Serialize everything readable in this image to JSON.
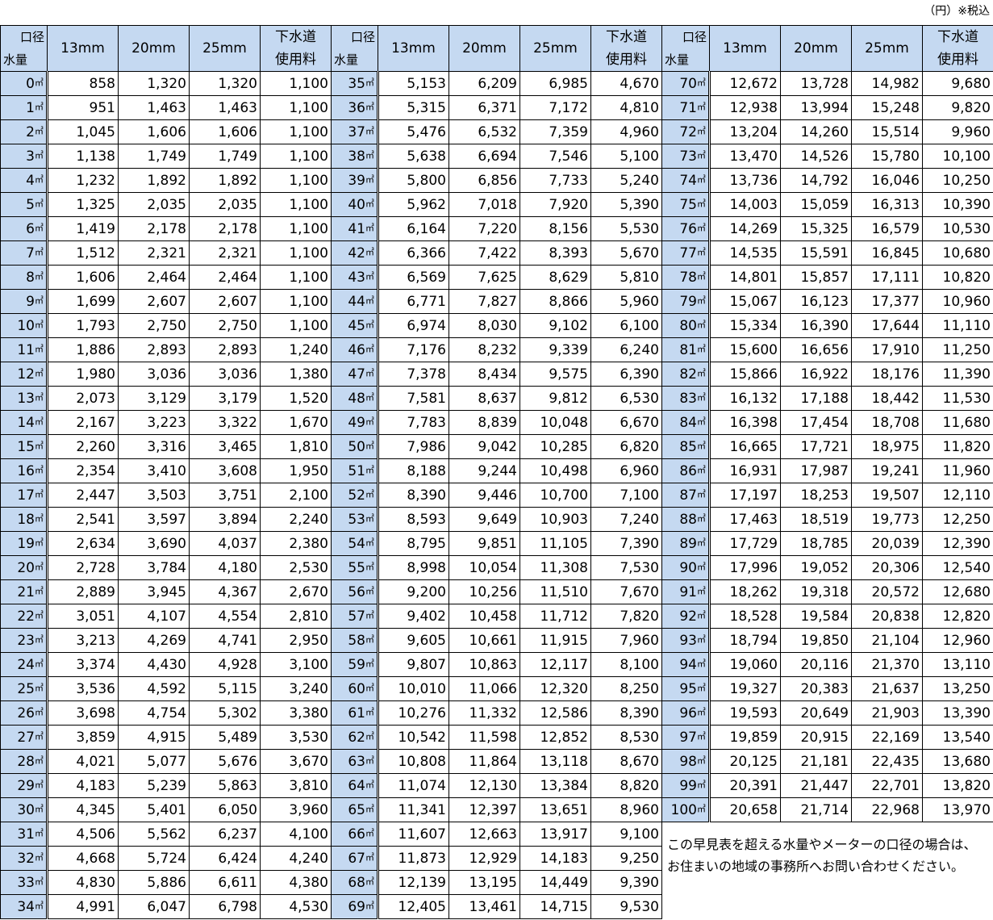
{
  "unit_note": "（円）※税込",
  "header": {
    "corner_top": "口径",
    "corner_bottom": "水量",
    "col_13": "13mm",
    "col_20": "20mm",
    "col_25": "25mm",
    "sewer_line1": "下水道",
    "sewer_line2": "使用料"
  },
  "unit_suffix": "㎥",
  "note": "この早見表を超える水量やメーターの口径の場合は、お住まいの地域の事務所へお問い合わせください。",
  "table": [
    [
      [
        "0",
        "858",
        "1,320",
        "1,320",
        "1,100"
      ],
      [
        "35",
        "5,153",
        "6,209",
        "6,985",
        "4,670"
      ],
      [
        "70",
        "12,672",
        "13,728",
        "14,982",
        "9,680"
      ]
    ],
    [
      [
        "1",
        "951",
        "1,463",
        "1,463",
        "1,100"
      ],
      [
        "36",
        "5,315",
        "6,371",
        "7,172",
        "4,810"
      ],
      [
        "71",
        "12,938",
        "13,994",
        "15,248",
        "9,820"
      ]
    ],
    [
      [
        "2",
        "1,045",
        "1,606",
        "1,606",
        "1,100"
      ],
      [
        "37",
        "5,476",
        "6,532",
        "7,359",
        "4,960"
      ],
      [
        "72",
        "13,204",
        "14,260",
        "15,514",
        "9,960"
      ]
    ],
    [
      [
        "3",
        "1,138",
        "1,749",
        "1,749",
        "1,100"
      ],
      [
        "38",
        "5,638",
        "6,694",
        "7,546",
        "5,100"
      ],
      [
        "73",
        "13,470",
        "14,526",
        "15,780",
        "10,100"
      ]
    ],
    [
      [
        "4",
        "1,232",
        "1,892",
        "1,892",
        "1,100"
      ],
      [
        "39",
        "5,800",
        "6,856",
        "7,733",
        "5,240"
      ],
      [
        "74",
        "13,736",
        "14,792",
        "16,046",
        "10,250"
      ]
    ],
    [
      [
        "5",
        "1,325",
        "2,035",
        "2,035",
        "1,100"
      ],
      [
        "40",
        "5,962",
        "7,018",
        "7,920",
        "5,390"
      ],
      [
        "75",
        "14,003",
        "15,059",
        "16,313",
        "10,390"
      ]
    ],
    [
      [
        "6",
        "1,419",
        "2,178",
        "2,178",
        "1,100"
      ],
      [
        "41",
        "6,164",
        "7,220",
        "8,156",
        "5,530"
      ],
      [
        "76",
        "14,269",
        "15,325",
        "16,579",
        "10,530"
      ]
    ],
    [
      [
        "7",
        "1,512",
        "2,321",
        "2,321",
        "1,100"
      ],
      [
        "42",
        "6,366",
        "7,422",
        "8,393",
        "5,670"
      ],
      [
        "77",
        "14,535",
        "15,591",
        "16,845",
        "10,680"
      ]
    ],
    [
      [
        "8",
        "1,606",
        "2,464",
        "2,464",
        "1,100"
      ],
      [
        "43",
        "6,569",
        "7,625",
        "8,629",
        "5,810"
      ],
      [
        "78",
        "14,801",
        "15,857",
        "17,111",
        "10,820"
      ]
    ],
    [
      [
        "9",
        "1,699",
        "2,607",
        "2,607",
        "1,100"
      ],
      [
        "44",
        "6,771",
        "7,827",
        "8,866",
        "5,960"
      ],
      [
        "79",
        "15,067",
        "16,123",
        "17,377",
        "10,960"
      ]
    ],
    [
      [
        "10",
        "1,793",
        "2,750",
        "2,750",
        "1,100"
      ],
      [
        "45",
        "6,974",
        "8,030",
        "9,102",
        "6,100"
      ],
      [
        "80",
        "15,334",
        "16,390",
        "17,644",
        "11,110"
      ]
    ],
    [
      [
        "11",
        "1,886",
        "2,893",
        "2,893",
        "1,240"
      ],
      [
        "46",
        "7,176",
        "8,232",
        "9,339",
        "6,240"
      ],
      [
        "81",
        "15,600",
        "16,656",
        "17,910",
        "11,250"
      ]
    ],
    [
      [
        "12",
        "1,980",
        "3,036",
        "3,036",
        "1,380"
      ],
      [
        "47",
        "7,378",
        "8,434",
        "9,575",
        "6,390"
      ],
      [
        "82",
        "15,866",
        "16,922",
        "18,176",
        "11,390"
      ]
    ],
    [
      [
        "13",
        "2,073",
        "3,129",
        "3,179",
        "1,520"
      ],
      [
        "48",
        "7,581",
        "8,637",
        "9,812",
        "6,530"
      ],
      [
        "83",
        "16,132",
        "17,188",
        "18,442",
        "11,530"
      ]
    ],
    [
      [
        "14",
        "2,167",
        "3,223",
        "3,322",
        "1,670"
      ],
      [
        "49",
        "7,783",
        "8,839",
        "10,048",
        "6,670"
      ],
      [
        "84",
        "16,398",
        "17,454",
        "18,708",
        "11,680"
      ]
    ],
    [
      [
        "15",
        "2,260",
        "3,316",
        "3,465",
        "1,810"
      ],
      [
        "50",
        "7,986",
        "9,042",
        "10,285",
        "6,820"
      ],
      [
        "85",
        "16,665",
        "17,721",
        "18,975",
        "11,820"
      ]
    ],
    [
      [
        "16",
        "2,354",
        "3,410",
        "3,608",
        "1,950"
      ],
      [
        "51",
        "8,188",
        "9,244",
        "10,498",
        "6,960"
      ],
      [
        "86",
        "16,931",
        "17,987",
        "19,241",
        "11,960"
      ]
    ],
    [
      [
        "17",
        "2,447",
        "3,503",
        "3,751",
        "2,100"
      ],
      [
        "52",
        "8,390",
        "9,446",
        "10,700",
        "7,100"
      ],
      [
        "87",
        "17,197",
        "18,253",
        "19,507",
        "12,110"
      ]
    ],
    [
      [
        "18",
        "2,541",
        "3,597",
        "3,894",
        "2,240"
      ],
      [
        "53",
        "8,593",
        "9,649",
        "10,903",
        "7,240"
      ],
      [
        "88",
        "17,463",
        "18,519",
        "19,773",
        "12,250"
      ]
    ],
    [
      [
        "19",
        "2,634",
        "3,690",
        "4,037",
        "2,380"
      ],
      [
        "54",
        "8,795",
        "9,851",
        "11,105",
        "7,390"
      ],
      [
        "89",
        "17,729",
        "18,785",
        "20,039",
        "12,390"
      ]
    ],
    [
      [
        "20",
        "2,728",
        "3,784",
        "4,180",
        "2,530"
      ],
      [
        "55",
        "8,998",
        "10,054",
        "11,308",
        "7,530"
      ],
      [
        "90",
        "17,996",
        "19,052",
        "20,306",
        "12,540"
      ]
    ],
    [
      [
        "21",
        "2,889",
        "3,945",
        "4,367",
        "2,670"
      ],
      [
        "56",
        "9,200",
        "10,256",
        "11,510",
        "7,670"
      ],
      [
        "91",
        "18,262",
        "19,318",
        "20,572",
        "12,680"
      ]
    ],
    [
      [
        "22",
        "3,051",
        "4,107",
        "4,554",
        "2,810"
      ],
      [
        "57",
        "9,402",
        "10,458",
        "11,712",
        "7,820"
      ],
      [
        "92",
        "18,528",
        "19,584",
        "20,838",
        "12,820"
      ]
    ],
    [
      [
        "23",
        "3,213",
        "4,269",
        "4,741",
        "2,950"
      ],
      [
        "58",
        "9,605",
        "10,661",
        "11,915",
        "7,960"
      ],
      [
        "93",
        "18,794",
        "19,850",
        "21,104",
        "12,960"
      ]
    ],
    [
      [
        "24",
        "3,374",
        "4,430",
        "4,928",
        "3,100"
      ],
      [
        "59",
        "9,807",
        "10,863",
        "12,117",
        "8,100"
      ],
      [
        "94",
        "19,060",
        "20,116",
        "21,370",
        "13,110"
      ]
    ],
    [
      [
        "25",
        "3,536",
        "4,592",
        "5,115",
        "3,240"
      ],
      [
        "60",
        "10,010",
        "11,066",
        "12,320",
        "8,250"
      ],
      [
        "95",
        "19,327",
        "20,383",
        "21,637",
        "13,250"
      ]
    ],
    [
      [
        "26",
        "3,698",
        "4,754",
        "5,302",
        "3,380"
      ],
      [
        "61",
        "10,276",
        "11,332",
        "12,586",
        "8,390"
      ],
      [
        "96",
        "19,593",
        "20,649",
        "21,903",
        "13,390"
      ]
    ],
    [
      [
        "27",
        "3,859",
        "4,915",
        "5,489",
        "3,530"
      ],
      [
        "62",
        "10,542",
        "11,598",
        "12,852",
        "8,530"
      ],
      [
        "97",
        "19,859",
        "20,915",
        "22,169",
        "13,540"
      ]
    ],
    [
      [
        "28",
        "4,021",
        "5,077",
        "5,676",
        "3,670"
      ],
      [
        "63",
        "10,808",
        "11,864",
        "13,118",
        "8,670"
      ],
      [
        "98",
        "20,125",
        "21,181",
        "22,435",
        "13,680"
      ]
    ],
    [
      [
        "29",
        "4,183",
        "5,239",
        "5,863",
        "3,810"
      ],
      [
        "64",
        "11,074",
        "12,130",
        "13,384",
        "8,820"
      ],
      [
        "99",
        "20,391",
        "21,447",
        "22,701",
        "13,820"
      ]
    ],
    [
      [
        "30",
        "4,345",
        "5,401",
        "6,050",
        "3,960"
      ],
      [
        "65",
        "11,341",
        "12,397",
        "13,651",
        "8,960"
      ],
      [
        "100",
        "20,658",
        "21,714",
        "22,968",
        "13,970"
      ]
    ],
    [
      [
        "31",
        "4,506",
        "5,562",
        "6,237",
        "4,100"
      ],
      [
        "66",
        "11,607",
        "12,663",
        "13,917",
        "9,100"
      ]
    ],
    [
      [
        "32",
        "4,668",
        "5,724",
        "6,424",
        "4,240"
      ],
      [
        "67",
        "11,873",
        "12,929",
        "14,183",
        "9,250"
      ]
    ],
    [
      [
        "33",
        "4,830",
        "5,886",
        "6,611",
        "4,380"
      ],
      [
        "68",
        "12,139",
        "13,195",
        "14,449",
        "9,390"
      ]
    ],
    [
      [
        "34",
        "4,991",
        "6,047",
        "6,798",
        "4,530"
      ],
      [
        "69",
        "12,405",
        "13,461",
        "14,715",
        "9,530"
      ]
    ]
  ]
}
